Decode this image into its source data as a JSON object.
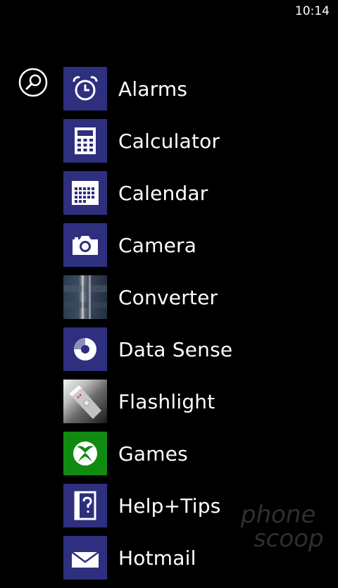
{
  "status_bar": {
    "time": "10:14"
  },
  "search": {
    "icon": "search-icon"
  },
  "apps": [
    {
      "name": "Alarms",
      "icon": "alarm-clock-icon"
    },
    {
      "name": "Calculator",
      "icon": "calculator-icon"
    },
    {
      "name": "Calendar",
      "icon": "calendar-icon"
    },
    {
      "name": "Camera",
      "icon": "camera-icon"
    },
    {
      "name": "Converter",
      "icon": "converter-icon"
    },
    {
      "name": "Data Sense",
      "icon": "data-sense-icon"
    },
    {
      "name": "Flashlight",
      "icon": "flashlight-icon"
    },
    {
      "name": "Games",
      "icon": "xbox-controller-icon"
    },
    {
      "name": "Help+Tips",
      "icon": "help-book-icon"
    },
    {
      "name": "Hotmail",
      "icon": "mail-icon"
    }
  ],
  "watermark": {
    "brand_line1": "phone",
    "brand_line2": "scoop"
  },
  "colors": {
    "tile_accent": "#2e2f7e",
    "games_tile": "#118a11",
    "background": "#000000",
    "text": "#ffffff"
  }
}
